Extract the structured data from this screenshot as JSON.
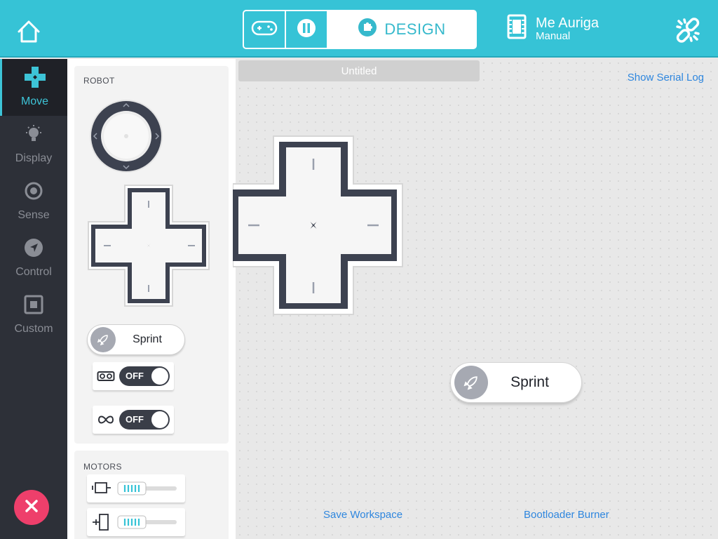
{
  "header": {
    "design_label": "DESIGN",
    "device_name": "Me Auriga",
    "device_mode": "Manual"
  },
  "sidebar": {
    "items": [
      {
        "label": "Move",
        "icon": "dpad-icon",
        "active": true
      },
      {
        "label": "Display",
        "icon": "lightbulb-icon"
      },
      {
        "label": "Sense",
        "icon": "sensor-icon"
      },
      {
        "label": "Control",
        "icon": "navigation-icon"
      },
      {
        "label": "Custom",
        "icon": "custom-square-icon"
      }
    ]
  },
  "palette": {
    "robot_title": "ROBOT",
    "sprint_label": "Sprint",
    "toggle1_state": "OFF",
    "toggle2_state": "OFF",
    "motors_title": "MOTORS"
  },
  "canvas": {
    "title": "Untitled",
    "serial_log": "Show Serial Log",
    "sprint_label": "Sprint",
    "save_workspace": "Save Workspace",
    "bootloader": "Bootloader Burner"
  },
  "colors": {
    "accent": "#36c3d6",
    "nav_bg": "#2d3038",
    "link": "#2e86de",
    "close": "#ee3f6b"
  }
}
